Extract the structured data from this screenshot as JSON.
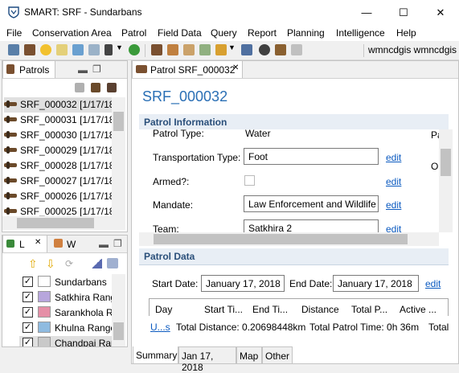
{
  "window": {
    "title": "SMART: SRF - Sundarbans",
    "minimize": "—",
    "maximize": "☐",
    "close": "✕"
  },
  "menu": [
    "File",
    "Conservation Area",
    "Patrol",
    "Field Data",
    "Query",
    "Report",
    "Planning",
    "Intelligence",
    "Help"
  ],
  "toolbar": {
    "user": "wmncdgis wmncdgis"
  },
  "patrols_panel": {
    "tab": "Patrols",
    "rows": [
      {
        "id": "SRF_000032",
        "date": "[1/17/18"
      },
      {
        "id": "SRF_000031",
        "date": "[1/17/18"
      },
      {
        "id": "SRF_000030",
        "date": "[1/17/18"
      },
      {
        "id": "SRF_000029",
        "date": "[1/17/18"
      },
      {
        "id": "SRF_000028",
        "date": "[1/17/18"
      },
      {
        "id": "SRF_000027",
        "date": "[1/17/18"
      },
      {
        "id": "SRF_000026",
        "date": "[1/17/18"
      },
      {
        "id": "SRF_000025",
        "date": "[1/17/18"
      }
    ]
  },
  "layers_panel": {
    "tab1": "L",
    "tab2": "W",
    "layers": [
      {
        "name": "Sundarbans",
        "color": "#ffffff"
      },
      {
        "name": "Satkhira Rang",
        "color": "#b7a6dc"
      },
      {
        "name": "Sarankhola R",
        "color": "#e58fa7"
      },
      {
        "name": "Khulna Range",
        "color": "#8fbbe0"
      },
      {
        "name": "Chandpai Ran",
        "color": "#c9c9c9"
      }
    ]
  },
  "editor": {
    "tab": "Patrol SRF_000032",
    "heading": "SRF_000032",
    "patrol_info": {
      "title": "Patrol Information",
      "type_label": "Patrol Type:",
      "type_value": "Water",
      "right_label": "Pa",
      "right_label2": "Ol",
      "transport_label": "Transportation Type:",
      "transport_value": "Foot",
      "armed_label": "Armed?:",
      "mandate_label": "Mandate:",
      "mandate_value": "Law Enforcement and Wildlife",
      "team_label": "Team:",
      "team_value": "Satkhira 2",
      "edit": "edit"
    },
    "patrol_data": {
      "title": "Patrol Data",
      "start_label": "Start Date:",
      "start_value": "January 17, 2018",
      "end_label": "End Date:",
      "end_value": "January 17, 2018",
      "edit": "edit",
      "columns": [
        "Day",
        "Start Ti...",
        "End Ti...",
        "Distance",
        "Total P...",
        "Active ..."
      ],
      "units_link": "U...s",
      "total_distance": "Total Distance: 0.20698448km",
      "total_time": "Total Patrol Time: 0h 36m",
      "total_more": "Total"
    },
    "bottom_tabs": [
      "Summary",
      "Jan 17, 2018",
      "Map",
      "Other"
    ]
  }
}
